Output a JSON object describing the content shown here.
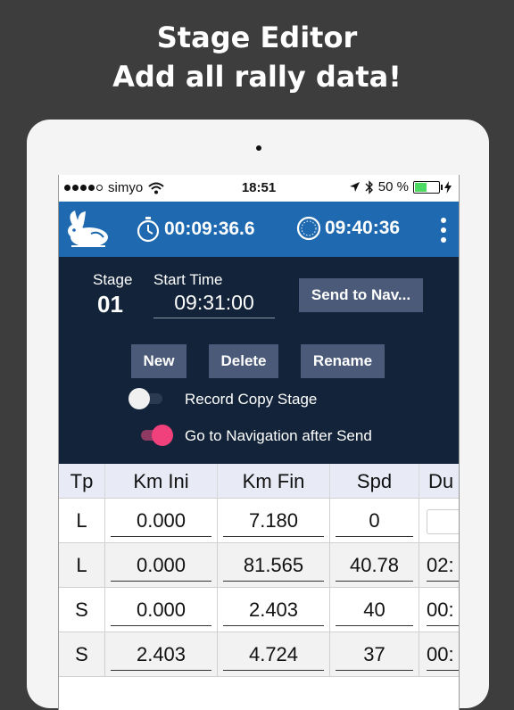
{
  "promo": {
    "line1": "Stage Editor",
    "line2": "Add all rally data!"
  },
  "status_bar": {
    "carrier": "simyo",
    "time": "18:51",
    "battery": "50 %",
    "battery_level": 0.5
  },
  "app_bar": {
    "elapsed_timer": "00:09:36.6",
    "clock": "09:40:36",
    "accent": "#1f69b0"
  },
  "stage": {
    "stage_label": "Stage",
    "stage_number": "01",
    "start_time_label": "Start Time",
    "start_time_value": "09:31:00",
    "send_button": "Send to Nav...",
    "new_button": "New",
    "delete_button": "Delete",
    "rename_button": "Rename",
    "record_copy_label": "Record Copy Stage",
    "record_copy_on": false,
    "goto_nav_label": "Go to Navigation after Send",
    "goto_nav_on": true
  },
  "table": {
    "columns": [
      "Tp",
      "Km Ini",
      "Km Fin",
      "Spd",
      "Du"
    ],
    "rows": [
      {
        "tp": "L",
        "km_ini": "0.000",
        "km_fin": "7.180",
        "spd": "0",
        "du": ""
      },
      {
        "tp": "L",
        "km_ini": "0.000",
        "km_fin": "81.565",
        "spd": "40.78",
        "du": "02:"
      },
      {
        "tp": "S",
        "km_ini": "0.000",
        "km_fin": "2.403",
        "spd": "40",
        "du": "00:"
      },
      {
        "tp": "S",
        "km_ini": "2.403",
        "km_fin": "4.724",
        "spd": "37",
        "du": "00:"
      }
    ]
  }
}
